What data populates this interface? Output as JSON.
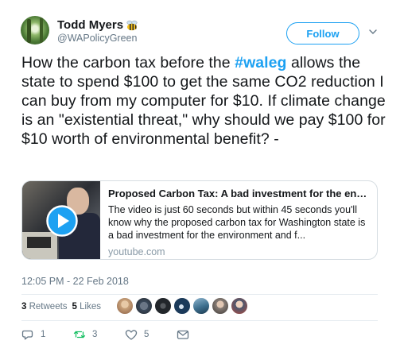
{
  "author": {
    "display_name": "Todd Myers",
    "handle": "@WAPolicyGreen",
    "badge_icon": "bee-icon"
  },
  "follow_button": {
    "label": "Follow",
    "color": "#1da1f2"
  },
  "tweet": {
    "text_before": "How the carbon tax before the ",
    "hashtag": "#waleg",
    "text_after": " allows the state to spend $100 to get the same CO2 reduction I can buy from my computer for $10. If climate change is an \"existential threat,\" why should we pay $100 for $10 worth of environmental benefit? -"
  },
  "card": {
    "title": "Proposed Carbon Tax: A bad investment for the environme...",
    "description": "The video is just 60 seconds but within 45 seconds you'll know why the proposed carbon tax for Washington state is a bad investment for the environment and f...",
    "domain": "youtube.com",
    "media_icon": "play-icon"
  },
  "timestamp": "12:05 PM - 22 Feb 2018",
  "stats": {
    "retweets_count": "3",
    "retweets_label": "Retweets",
    "likes_count": "5",
    "likes_label": "Likes"
  },
  "likers": [
    "#c9a27a",
    "#3b4a5c",
    "#22262b",
    "#1b3a5a",
    "#3e6f8e",
    "#8a7f78",
    "#b04a3e"
  ],
  "actions": {
    "reply_count": "1",
    "retweet_count": "3",
    "like_count": "5"
  }
}
